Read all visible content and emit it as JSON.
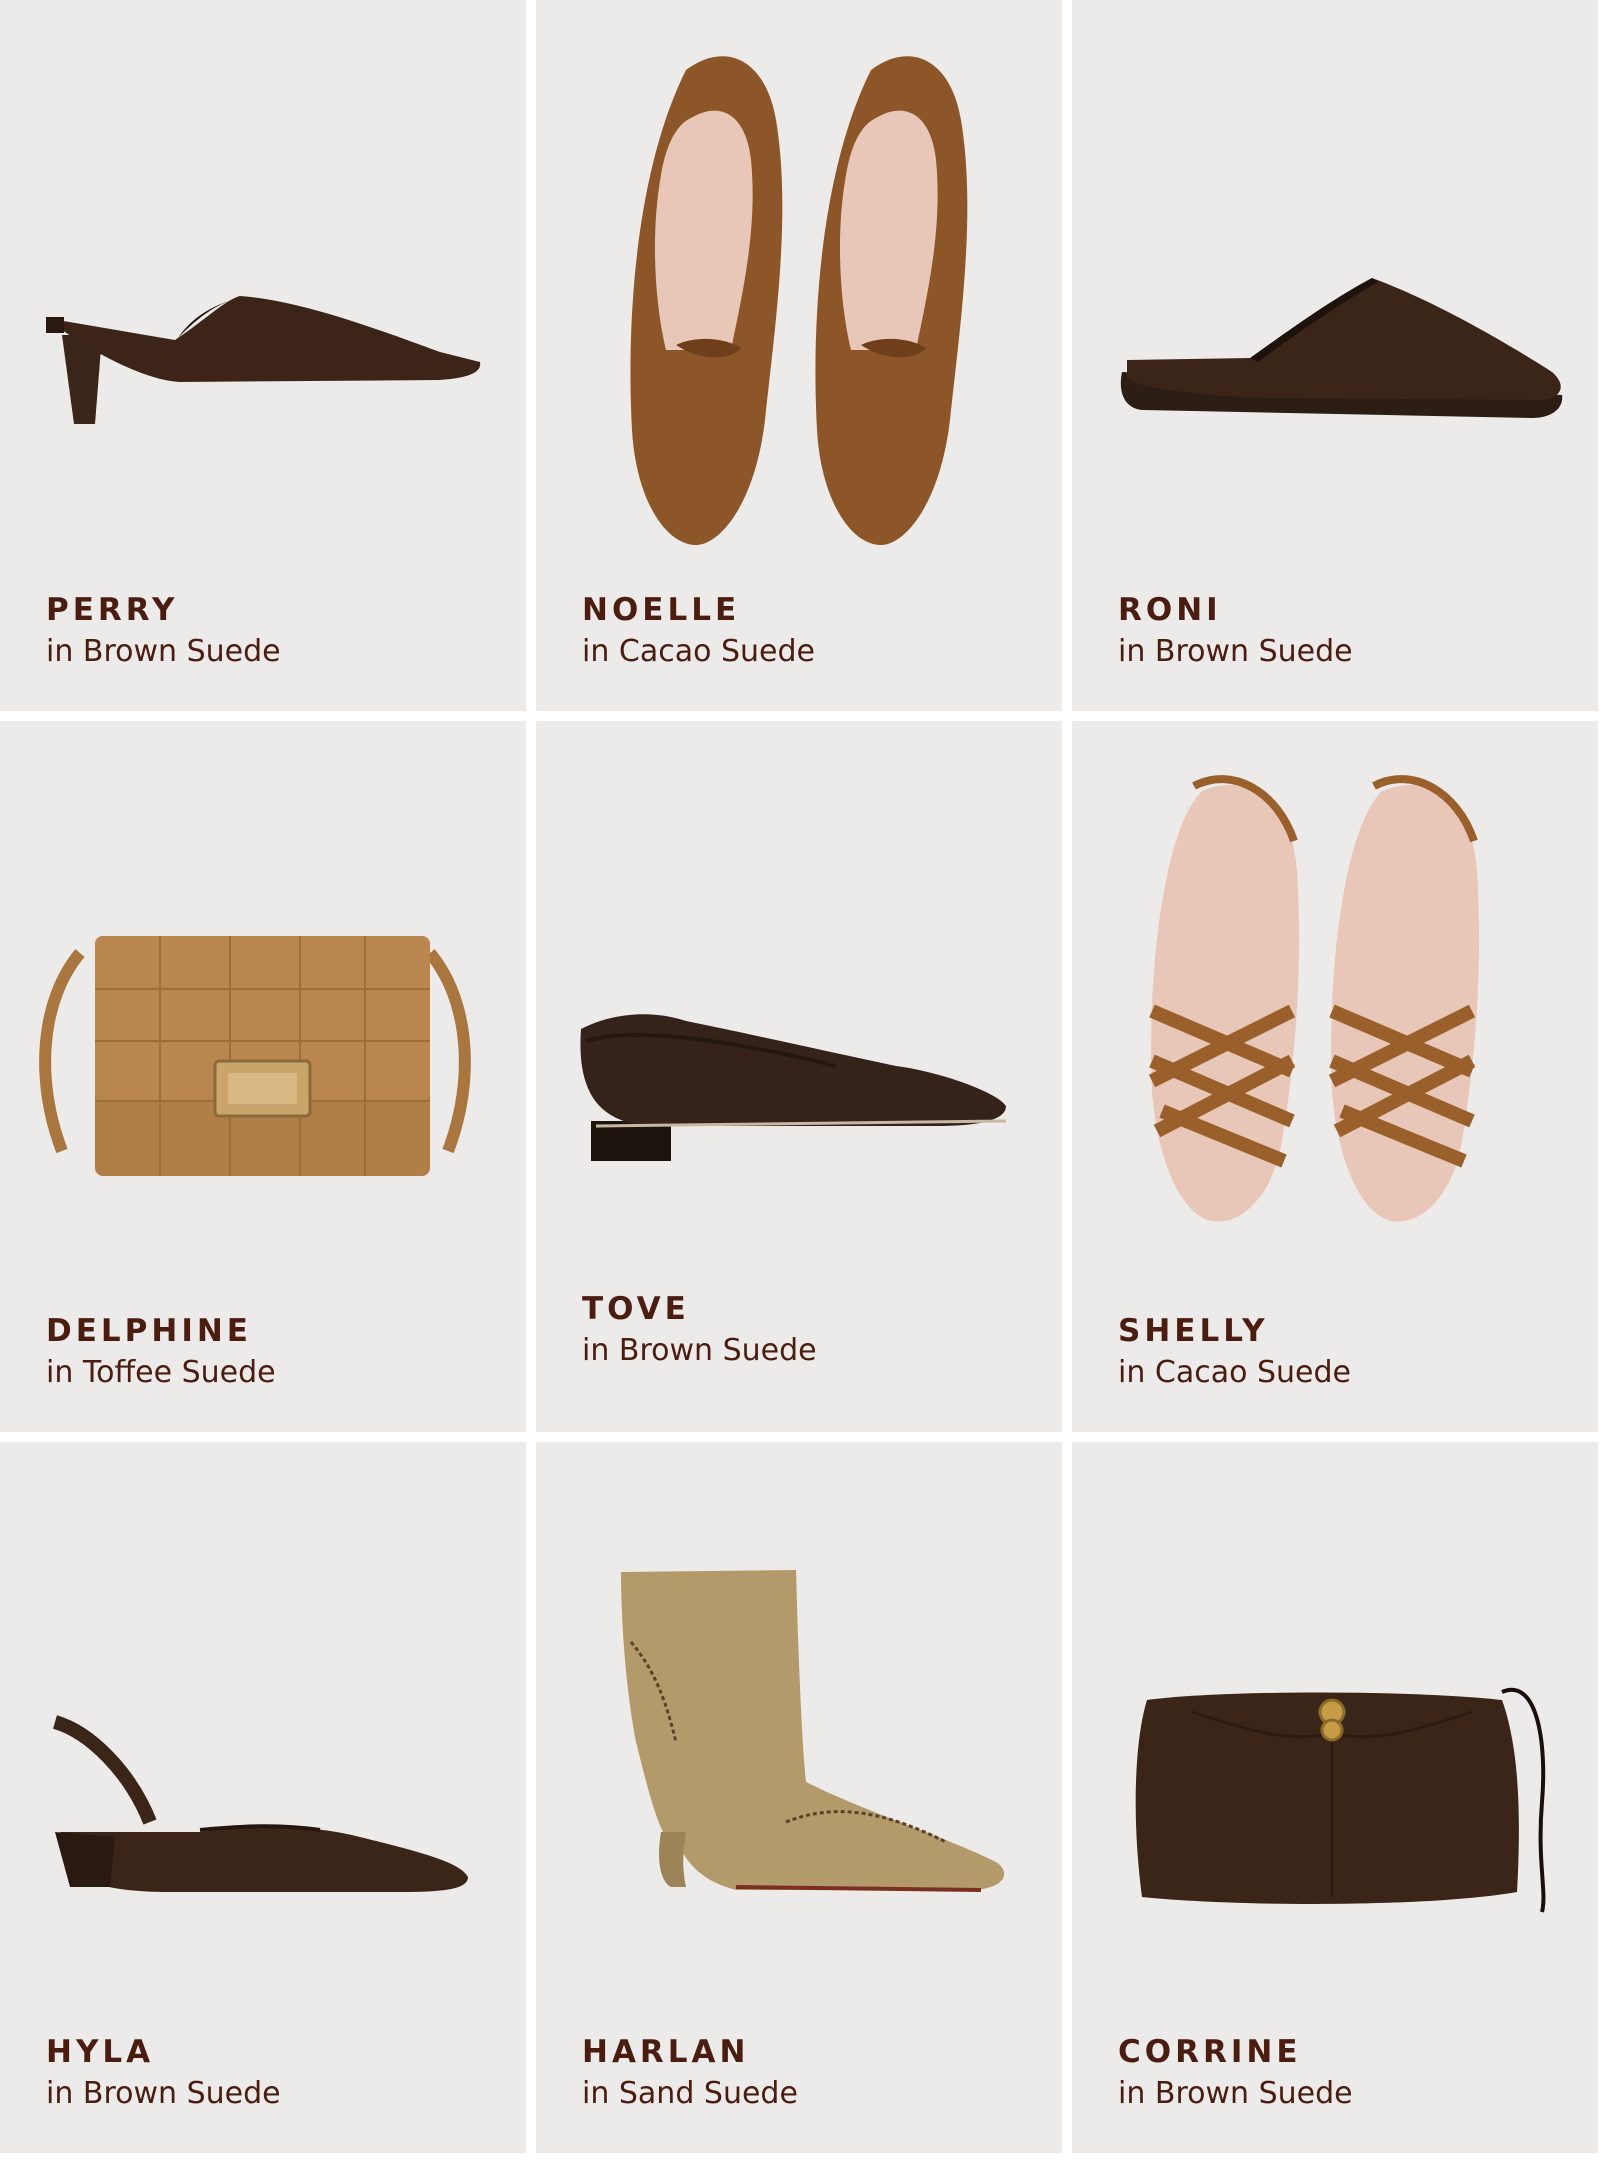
{
  "products": [
    {
      "name": "PERRY",
      "color": "in Brown Suede"
    },
    {
      "name": "NOELLE",
      "color": "in Cacao Suede"
    },
    {
      "name": "RONI",
      "color": "in Brown Suede"
    },
    {
      "name": "DELPHINE",
      "color": "in Toffee Suede"
    },
    {
      "name": "TOVE",
      "color": "in Brown Suede"
    },
    {
      "name": "SHELLY",
      "color": "in Cacao Suede"
    },
    {
      "name": "HYLA",
      "color": "in Brown Suede"
    },
    {
      "name": "HARLAN",
      "color": "in Sand Suede"
    },
    {
      "name": "CORRINE",
      "color": "in Brown Suede"
    }
  ],
  "colors": {
    "tile_background": "#ecebea",
    "text": "#4a1d10",
    "brown_suede": "#3b2418",
    "cacao_suede": "#8d5628",
    "toffee_suede": "#b07e47",
    "sand_suede": "#b39a6b"
  }
}
